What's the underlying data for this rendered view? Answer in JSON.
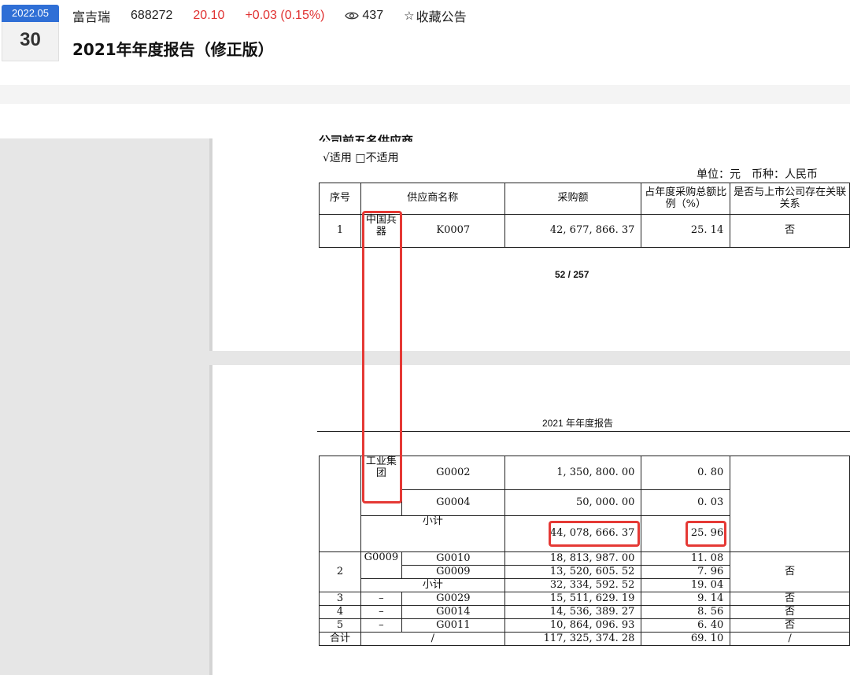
{
  "header": {
    "date_month": "2022.05",
    "date_day": "30",
    "company_name": "富吉瑞",
    "stock_code": "688272",
    "price": "20.10",
    "change": "+0.03 (0.15%)",
    "views": "437",
    "favorite_label": "收藏公告",
    "report_title": "2021年年度报告（修正版）"
  },
  "colors": {
    "accent": "#2f6fd6",
    "price_up": "#e03131",
    "highlight": "#e53935"
  },
  "document": {
    "cut_heading": "公司前五名供应商",
    "applicable": "√适用 □不适用",
    "unit_line": "单位：元　币种：人民币",
    "page_number": "52 / 257",
    "page2_header": "2021 年年度报告",
    "table1": {
      "headers": [
        "序号",
        "供应商名称",
        "采购额",
        "占年度采购总额比例（%）",
        "是否与上市公司存在关联关系"
      ],
      "row": {
        "no": "1",
        "group": "中国兵器",
        "code": "K0007",
        "amount": "42, 677, 866. 37",
        "pct": "25. 14",
        "related": "否"
      }
    },
    "table2": {
      "group_cont": "工业集团",
      "r1": {
        "code": "G0002",
        "amount": "1, 350, 800. 00",
        "pct": "0. 80"
      },
      "r2": {
        "code": "G0004",
        "amount": "50, 000. 00",
        "pct": "0. 03"
      },
      "sub1": {
        "label": "小计",
        "amount": "44, 078, 666. 37",
        "pct": "25. 96"
      },
      "s2": {
        "no": "2",
        "group": "G0009",
        "related": "否",
        "r1": {
          "code": "G0010",
          "amount": "18, 813, 987. 00",
          "pct": "11. 08"
        },
        "r2": {
          "code": "G0009",
          "amount": "13, 520, 605. 52",
          "pct": "7. 96"
        },
        "sub": {
          "label": "小计",
          "amount": "32, 334, 592. 52",
          "pct": "19. 04"
        }
      },
      "s3": {
        "no": "3",
        "group": "–",
        "code": "G0029",
        "amount": "15, 511, 629. 19",
        "pct": "9. 14",
        "related": "否"
      },
      "s4": {
        "no": "4",
        "group": "–",
        "code": "G0014",
        "amount": "14, 536, 389. 27",
        "pct": "8. 56",
        "related": "否"
      },
      "s5": {
        "no": "5",
        "group": "–",
        "code": "G0011",
        "amount": "10, 864, 096. 93",
        "pct": "6. 40",
        "related": "否"
      },
      "total": {
        "label": "合计",
        "group": "/",
        "amount": "117, 325, 374. 28",
        "pct": "69. 10",
        "related": "/"
      }
    }
  }
}
